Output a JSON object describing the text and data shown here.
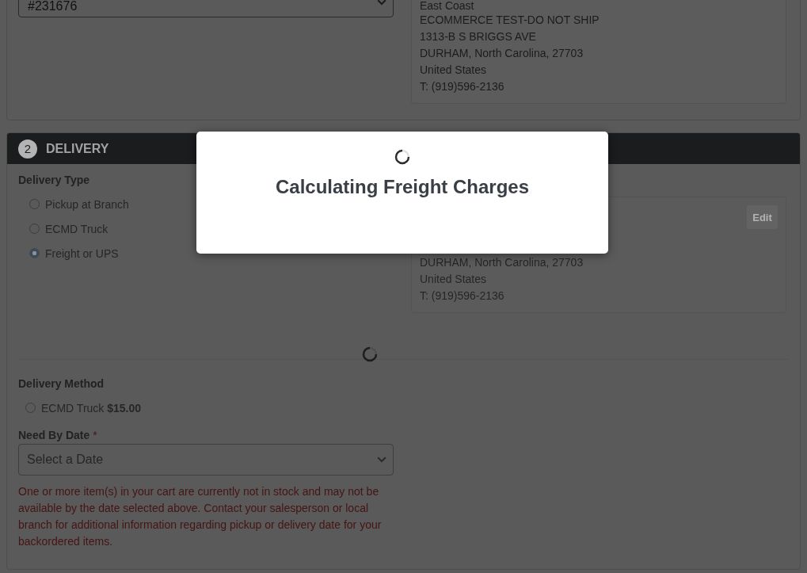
{
  "dropdown": {
    "value": "#231676"
  },
  "address_card": {
    "lines": [
      "East Coast",
      "ECOMMERCE TEST-DO NOT SHIP",
      "1313-B S BRIGGS AVE",
      "DURHAM, North Carolina, 27703",
      "United States",
      "T: (919)596-2136"
    ]
  },
  "delivery": {
    "step": "2",
    "title": "DELIVERY",
    "loading": true,
    "delivery_type": {
      "label": "Delivery Type",
      "options": [
        {
          "label": "Pickup at Branch",
          "selected": false
        },
        {
          "label": "ECMD Truck",
          "selected": false
        },
        {
          "label": "Freight or UPS",
          "selected": true
        }
      ]
    },
    "address_card": {
      "edit_button": "Edit",
      "lines": [
        "DURHAM, North Carolina, 27703",
        "United States",
        "T: (919)596-2136"
      ]
    },
    "delivery_method": {
      "label": "Delivery Method",
      "options": [
        {
          "label": "ECMD Truck **$15.00**",
          "selected": false
        }
      ]
    },
    "need_by_date": {
      "label": "Need By Date",
      "required_mark": "*",
      "placeholder": "Select a Date"
    },
    "stock_warning": "One or more item(s) in your cart are currently not in stock and may not be available by the date selected above. Contact your salesperson or local branch for additional information regarding pickup or delivery date for your backordered items."
  },
  "modal": {
    "title": "Calculating Freight Charges"
  }
}
